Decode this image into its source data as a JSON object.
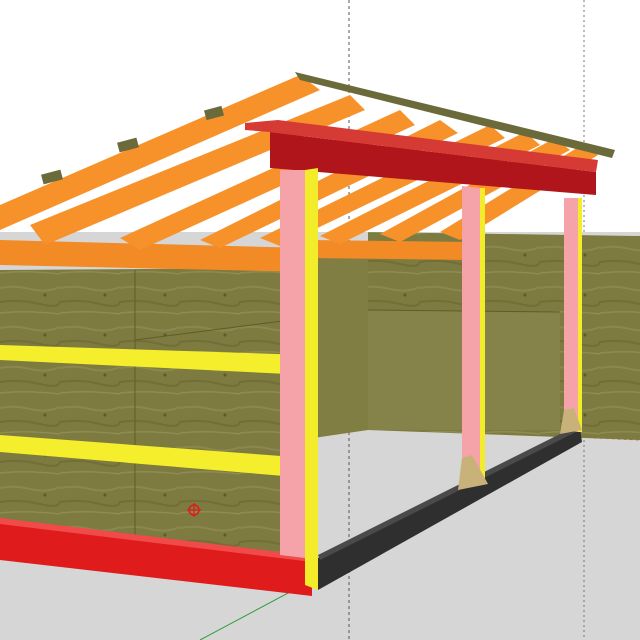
{
  "app": {
    "toolbar_color": "#1f5fa0",
    "sky_color": "#ffffff",
    "ground_color": "#d6d6d6"
  },
  "model": {
    "materials": {
      "rafter": "#f7922a",
      "rafter_top": "#ffb25a",
      "purlin": "#6b6a3a",
      "ridge_beam": "#b0151b",
      "ridge_beam_top": "#d63a34",
      "post": "#f5a3a8",
      "post_edge": "#f2ec2b",
      "girt_yellow": "#f5ee2d",
      "girt_orange": "#f28a25",
      "bottom_plate_red": "#e01b1b",
      "bottom_plate_dark": "#3a3a3a",
      "plywood": "#7c7a3e",
      "plywood_light": "#8e8a4a",
      "brace": "#c9b17a"
    }
  },
  "axes": {
    "red": "#e0403a",
    "green": "#2f9d3a",
    "blue": "#2f5fd0",
    "guide": "#555555"
  }
}
